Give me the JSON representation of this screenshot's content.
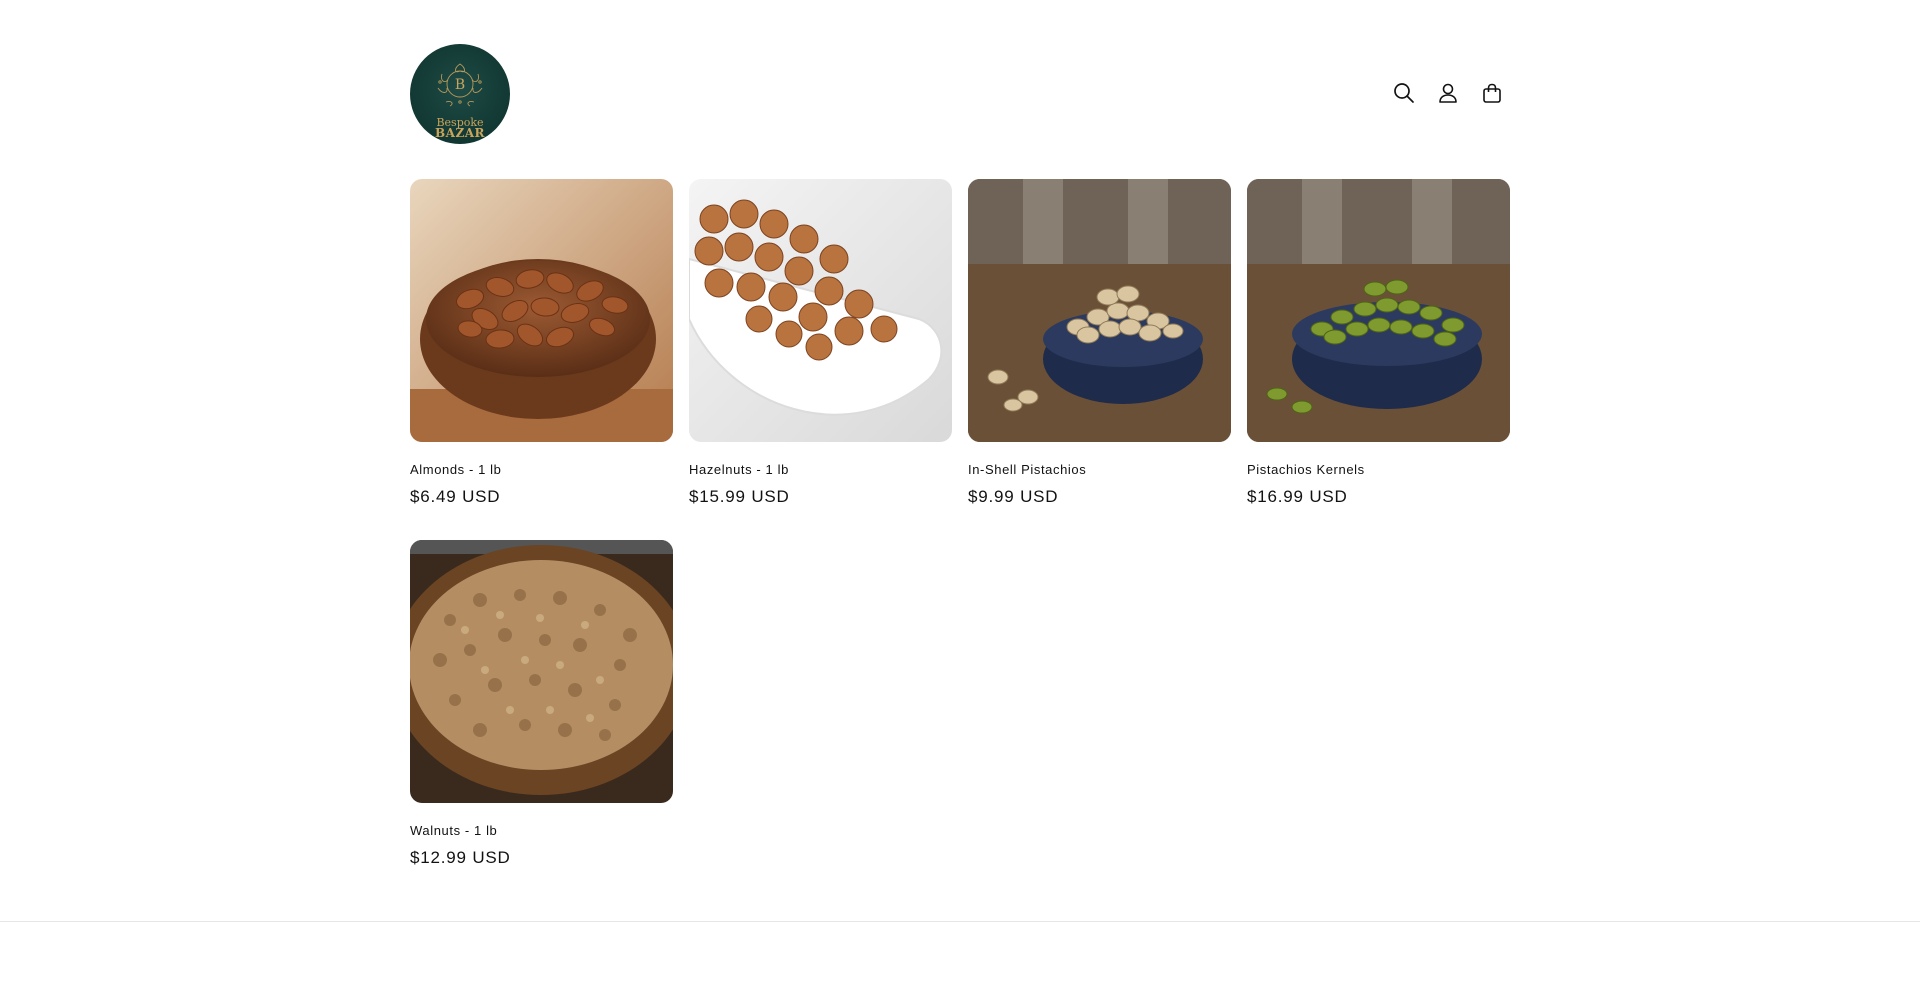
{
  "header": {
    "logo": {
      "line1": "Bespoke",
      "line2": "BAZAR",
      "monogram": "B"
    },
    "icons": {
      "search": "search-icon",
      "account": "user-icon",
      "cart": "bag-icon"
    }
  },
  "products": [
    {
      "title": "Almonds - 1 lb",
      "price": "$6.49 USD",
      "image": "almonds-in-wooden-bowl"
    },
    {
      "title": "Hazelnuts - 1 lb",
      "price": "$15.99 USD",
      "image": "hazelnuts-in-white-dish"
    },
    {
      "title": "In-Shell Pistachios",
      "price": "$9.99 USD",
      "image": "in-shell-pistachios-in-blue-bowl"
    },
    {
      "title": "Pistachios Kernels",
      "price": "$16.99 USD",
      "image": "pistachio-kernels-in-blue-bowl"
    },
    {
      "title": "Walnuts - 1 lb",
      "price": "$12.99 USD",
      "image": "walnuts-in-wooden-bowl"
    }
  ],
  "colors": {
    "logo_bg": "#123833",
    "logo_gold": "#c9a45c",
    "text": "#121212"
  }
}
